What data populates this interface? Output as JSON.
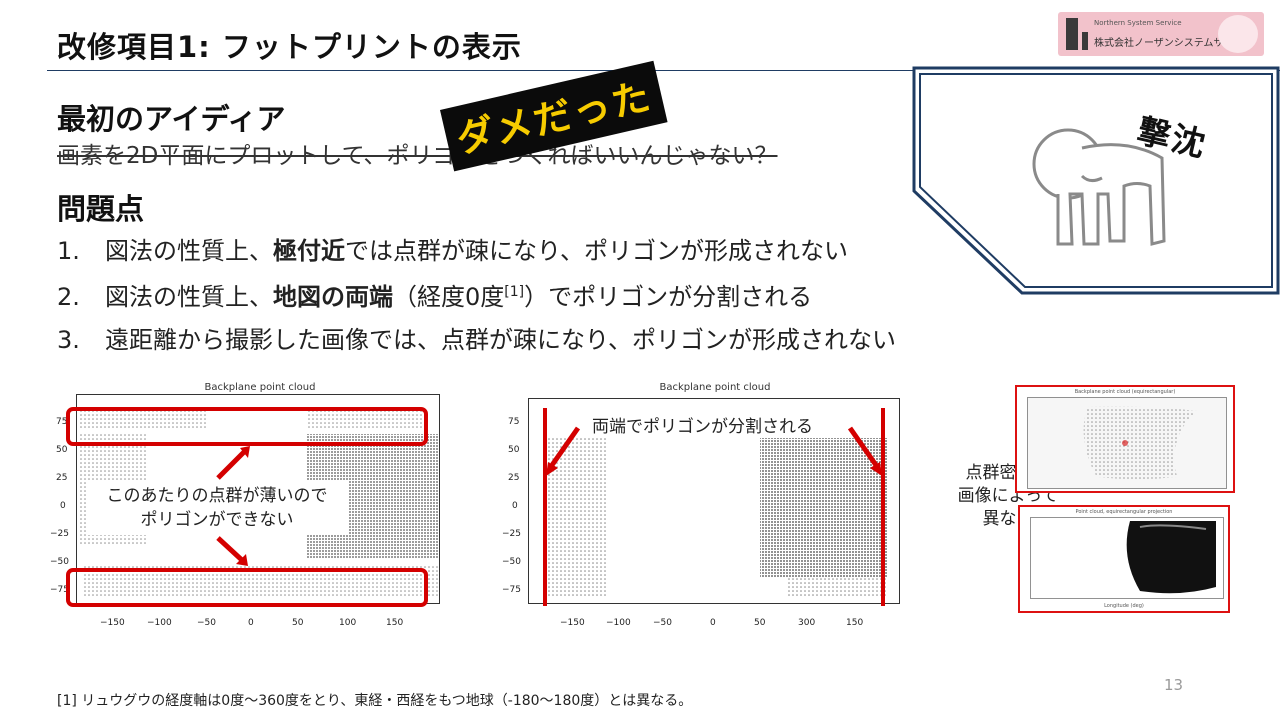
{
  "slide": {
    "title": "改修項目1: フットプリントの表示",
    "page_number": "13",
    "footnote": "[1] リュウグウの経度軸は0度〜360度をとり、東経・西経をもつ地球（-180〜180度）とは異なる。"
  },
  "logo": {
    "company": "株式会社ノーザンシステムサービス",
    "small_text": "Northern System Service"
  },
  "idea": {
    "heading": "最初のアイディア",
    "struck_text": "画素を2D平面にプロットして、ポリゴンをつくればいいんじゃない？",
    "stamp": "ダメだった"
  },
  "problems": {
    "heading": "問題点",
    "items": [
      {
        "num": "1.",
        "pre": "図法の性質上、",
        "bold": "極付近",
        "post": "では点群が疎になり、ポリゴンが形成されない",
        "sup": "",
        "post2": ""
      },
      {
        "num": "2.",
        "pre": "図法の性質上、",
        "bold": "地図の両端",
        "post": "（経度0度",
        "sup": "[1]",
        "post2": "）でポリゴンが分割される"
      },
      {
        "num": "3.",
        "pre": "遠距離から撮影した画像では、点群が疎になり、ポリゴンが形成されない",
        "bold": "",
        "post": "",
        "sup": "",
        "post2": ""
      }
    ]
  },
  "illustration": {
    "caption": "撃沈"
  },
  "plots": {
    "left_title": "Backplane point cloud",
    "middle_title": "Backplane point cloud",
    "y_ticks": [
      "75",
      "50",
      "25",
      "0",
      "−25",
      "−50",
      "−75"
    ],
    "x_ticks": [
      "−150",
      "−100",
      "−50",
      "0",
      "50",
      "100",
      "150"
    ],
    "x_ticks_middle": [
      "−150",
      "−100",
      "−50",
      "0",
      "50",
      "300",
      "150"
    ],
    "left_callout_line1": "このあたりの点群が薄いので",
    "left_callout_line2": "ポリゴンができない",
    "middle_callout": "両端でポリゴンが分割される",
    "density_line1": "点群密度が",
    "density_line2": "画像によって",
    "density_line3": "異なる",
    "mini_top_title": "Backplane point cloud (equirectangular)",
    "mini_bottom_title": "Point cloud, equirectangular projection",
    "mini_bottom_xlabel": "Longitude (deg)"
  },
  "colors": {
    "highlight_red": "#d40000",
    "stamp_bg": "#0b0b0b",
    "stamp_text": "#f7cc00",
    "rule_blue": "#1f3c63"
  }
}
